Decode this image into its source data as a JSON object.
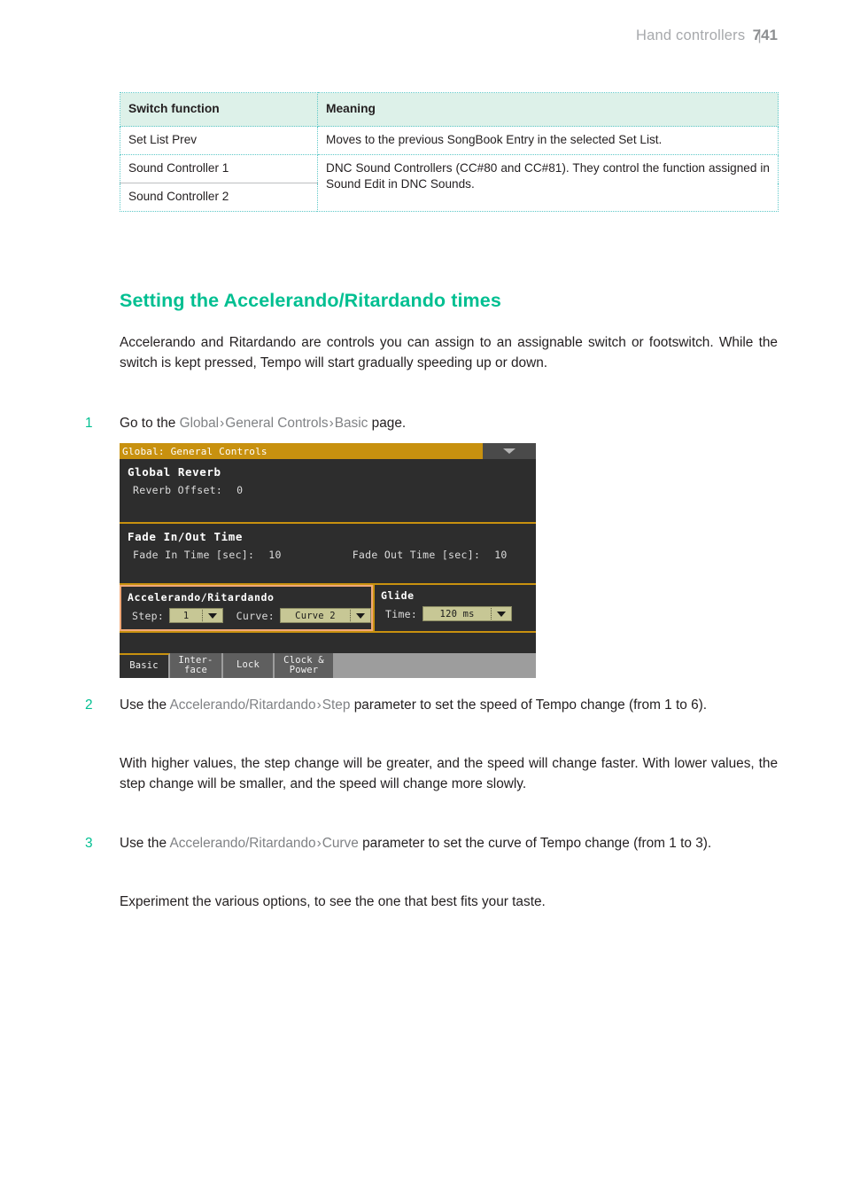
{
  "header": {
    "title": "Hand controllers",
    "bar": "|",
    "page_number": "741"
  },
  "table": {
    "columns": [
      "Switch function",
      "Meaning"
    ],
    "rows": [
      {
        "switch_function": "Set List Prev",
        "meaning": "Moves to the previous SongBook Entry in the selected Set List."
      },
      {
        "switch_function": "Sound Controller 1",
        "meaning": "DNC Sound Controllers (CC#80 and CC#81). They control the function assigned in Sound Edit in DNC Sounds."
      },
      {
        "switch_function": "Sound Controller 2",
        "meaning": ""
      }
    ]
  },
  "section": {
    "heading": "Setting the Accelerando/Ritardando times",
    "intro": "Accelerando and Ritardando are controls you can assign to an assignable switch or footswitch. While the switch is kept pressed, Tempo will start gradually speeding up or down."
  },
  "steps": [
    {
      "number": "1",
      "text_before": "Go to the ",
      "param1": "Global",
      "sep1": "›",
      "param2": "General Controls",
      "sep2": "›",
      "param3": "Basic",
      "text_after": " page."
    },
    {
      "number": "2",
      "text_before": "Use the ",
      "param1": "Accelerando/Ritardando",
      "sep1": "›",
      "param2": "Step",
      "text_after": " parameter to set the speed of Tempo change (from 1 to 6).",
      "sub_paragraph": "With higher values, the step change will be greater, and the speed will change faster. With lower values, the step change will be smaller, and the speed will change more slowly."
    },
    {
      "number": "3",
      "text_before": "Use the ",
      "param1": "Accelerando/Ritardando",
      "sep1": "›",
      "param2": "Curve",
      "text_after": " parameter to set the curve of Tempo change (from 1 to 3).",
      "sub_paragraph": "Experiment the various options, to see the one that best fits your taste."
    }
  ],
  "lcd": {
    "title": "Global: General Controls",
    "menu_icon": "chevron-down-icon",
    "reverb": {
      "section_title": "Global Reverb",
      "offset_label": "Reverb Offset:",
      "offset_value": "0"
    },
    "fade": {
      "section_title": "Fade In/Out Time",
      "in_label": "Fade In Time [sec]:",
      "in_value": "10",
      "out_label": "Fade Out Time [sec]:",
      "out_value": "10"
    },
    "accel": {
      "section_title": "Accelerando/Ritardando",
      "step_label": "Step:",
      "step_value": "1",
      "curve_label": "Curve:",
      "curve_value": "Curve 2"
    },
    "glide": {
      "section_title": "Glide",
      "time_label": "Time:",
      "time_value": "120 ms"
    },
    "tabs": [
      {
        "label": "Basic",
        "selected": true
      },
      {
        "label": "Inter-\nface",
        "selected": false
      },
      {
        "label": "Lock",
        "selected": false
      },
      {
        "label": "Clock &\nPower",
        "selected": false
      }
    ]
  },
  "colors": {
    "accent_teal": "#00bf91",
    "table_header_bg": "#ddf1e9",
    "table_border": "#5ec8c8",
    "lcd_gold": "#c8910f",
    "lcd_bg": "#2d2d2d",
    "highlight_border": "#f0a878",
    "combo_field": "#c7c795"
  }
}
